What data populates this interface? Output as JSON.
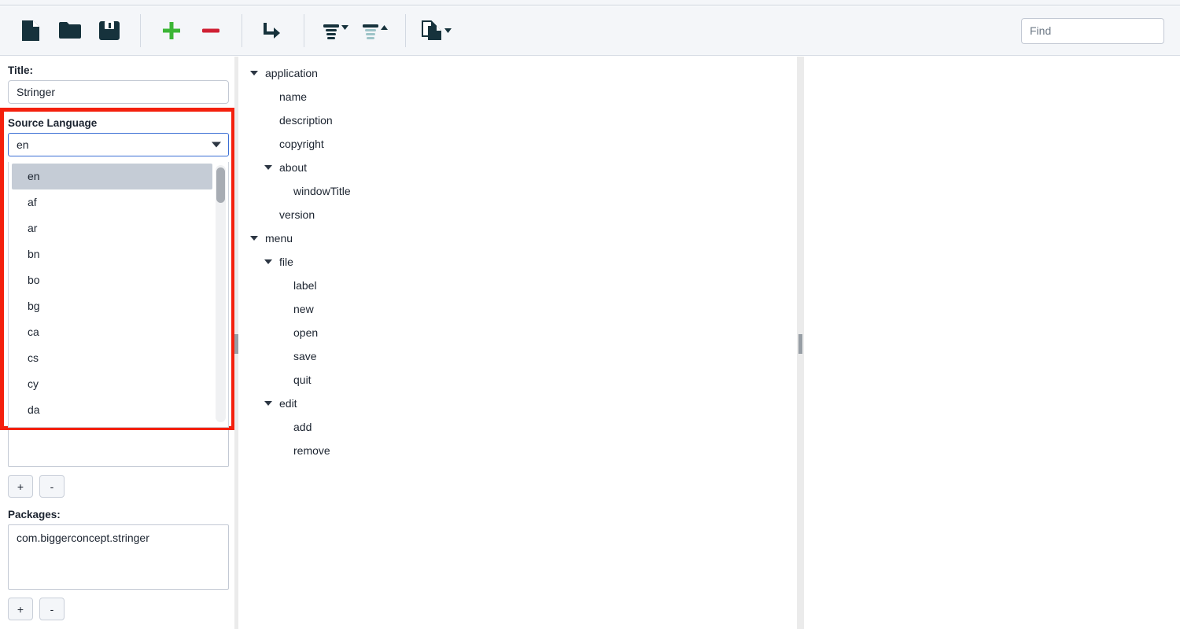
{
  "toolbar": {
    "buttons": [
      {
        "name": "new-file-button",
        "icon": "new-file-icon",
        "label": "New"
      },
      {
        "name": "open-folder-button",
        "icon": "open-folder-icon",
        "label": "Open"
      },
      {
        "name": "save-button",
        "icon": "save-floppy-icon",
        "label": "Save"
      },
      {
        "name": "add-button",
        "icon": "plus-icon",
        "label": "Add"
      },
      {
        "name": "remove-button",
        "icon": "minus-icon",
        "label": "Remove"
      },
      {
        "name": "move-button",
        "icon": "arrow-turn-right-icon",
        "label": "Move"
      },
      {
        "name": "sort-descending-button",
        "icon": "sort-down-icon",
        "label": "Sort Down"
      },
      {
        "name": "sort-ascending-button",
        "icon": "sort-up-icon",
        "label": "Sort Up"
      },
      {
        "name": "export-button",
        "icon": "copy-pages-icon",
        "label": "Export"
      }
    ],
    "find": {
      "placeholder": "Find",
      "value": ""
    }
  },
  "left_panel": {
    "title": {
      "label": "Title:",
      "value": "Stringer"
    },
    "source_language": {
      "label": "Source Language",
      "selected": "en",
      "options": [
        "en",
        "af",
        "ar",
        "bn",
        "bo",
        "bg",
        "ca",
        "cs",
        "cy",
        "da"
      ]
    },
    "languages_list": {
      "items": [],
      "add_label": "+",
      "remove_label": "-"
    },
    "packages": {
      "label": "Packages:",
      "items": [
        "com.biggerconcept.stringer"
      ],
      "add_label": "+",
      "remove_label": "-"
    }
  },
  "tree": {
    "nodes": [
      {
        "label": "application",
        "depth": 0,
        "expandable": true
      },
      {
        "label": "name",
        "depth": 1,
        "expandable": false
      },
      {
        "label": "description",
        "depth": 1,
        "expandable": false
      },
      {
        "label": "copyright",
        "depth": 1,
        "expandable": false
      },
      {
        "label": "about",
        "depth": 1,
        "expandable": true
      },
      {
        "label": "windowTitle",
        "depth": 2,
        "expandable": false
      },
      {
        "label": "version",
        "depth": 1,
        "expandable": false
      },
      {
        "label": "menu",
        "depth": 0,
        "expandable": true
      },
      {
        "label": "file",
        "depth": 1,
        "expandable": true
      },
      {
        "label": "label",
        "depth": 2,
        "expandable": false
      },
      {
        "label": "new",
        "depth": 2,
        "expandable": false
      },
      {
        "label": "open",
        "depth": 2,
        "expandable": false
      },
      {
        "label": "save",
        "depth": 2,
        "expandable": false
      },
      {
        "label": "quit",
        "depth": 2,
        "expandable": false
      },
      {
        "label": "edit",
        "depth": 1,
        "expandable": true
      },
      {
        "label": "add",
        "depth": 2,
        "expandable": false
      },
      {
        "label": "remove",
        "depth": 2,
        "expandable": false
      }
    ]
  },
  "colors": {
    "highlight": "#f4200d",
    "icon_dark": "#16323c",
    "accent_green": "#3cb536",
    "accent_red": "#cf2034",
    "focus_blue": "#3b6fd4",
    "toolbar_bg": "#f4f6f9"
  }
}
